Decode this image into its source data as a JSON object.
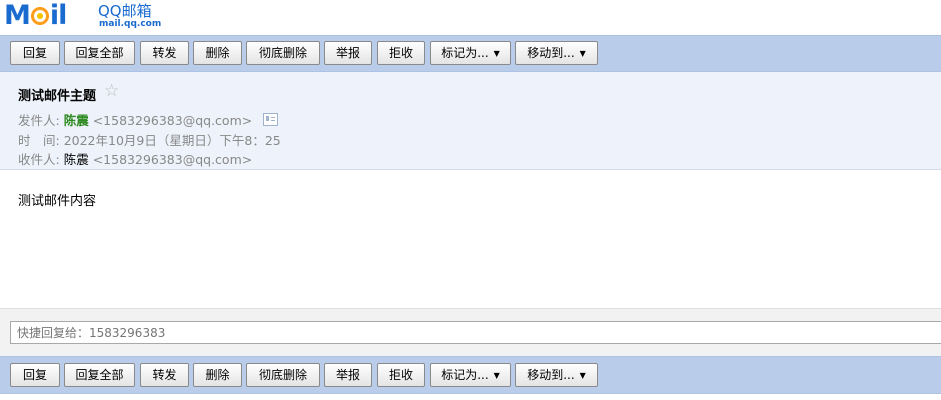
{
  "logo": {
    "mark": "Mail",
    "qq": "QQ邮箱",
    "domain": "mail.qq.com"
  },
  "toolbar": {
    "reply": "回复",
    "reply_all": "回复全部",
    "forward": "转发",
    "delete": "删除",
    "delete_forever": "彻底删除",
    "report": "举报",
    "reject": "拒收",
    "mark_as": "标记为...",
    "move_to": "移动到..."
  },
  "mail": {
    "subject": "测试邮件主题",
    "sender_label": "发件人:",
    "sender_name": "陈震",
    "sender_addr": "<1583296383@qq.com>",
    "time_label": "时　间:",
    "time_value": "2022年10月9日（星期日）下午8：25",
    "receiver_label": "收件人:",
    "receiver_name": "陈震",
    "receiver_addr": "<1583296383@qq.com>",
    "body": "测试邮件内容"
  },
  "quick_reply": {
    "placeholder": "快捷回复给：1583296383"
  },
  "colors": {
    "toolbar_bg": "#b9cdea",
    "header_bg": "#eef3fb",
    "sender_green": "#2e8b22",
    "brand_blue": "#1a6bd0"
  }
}
